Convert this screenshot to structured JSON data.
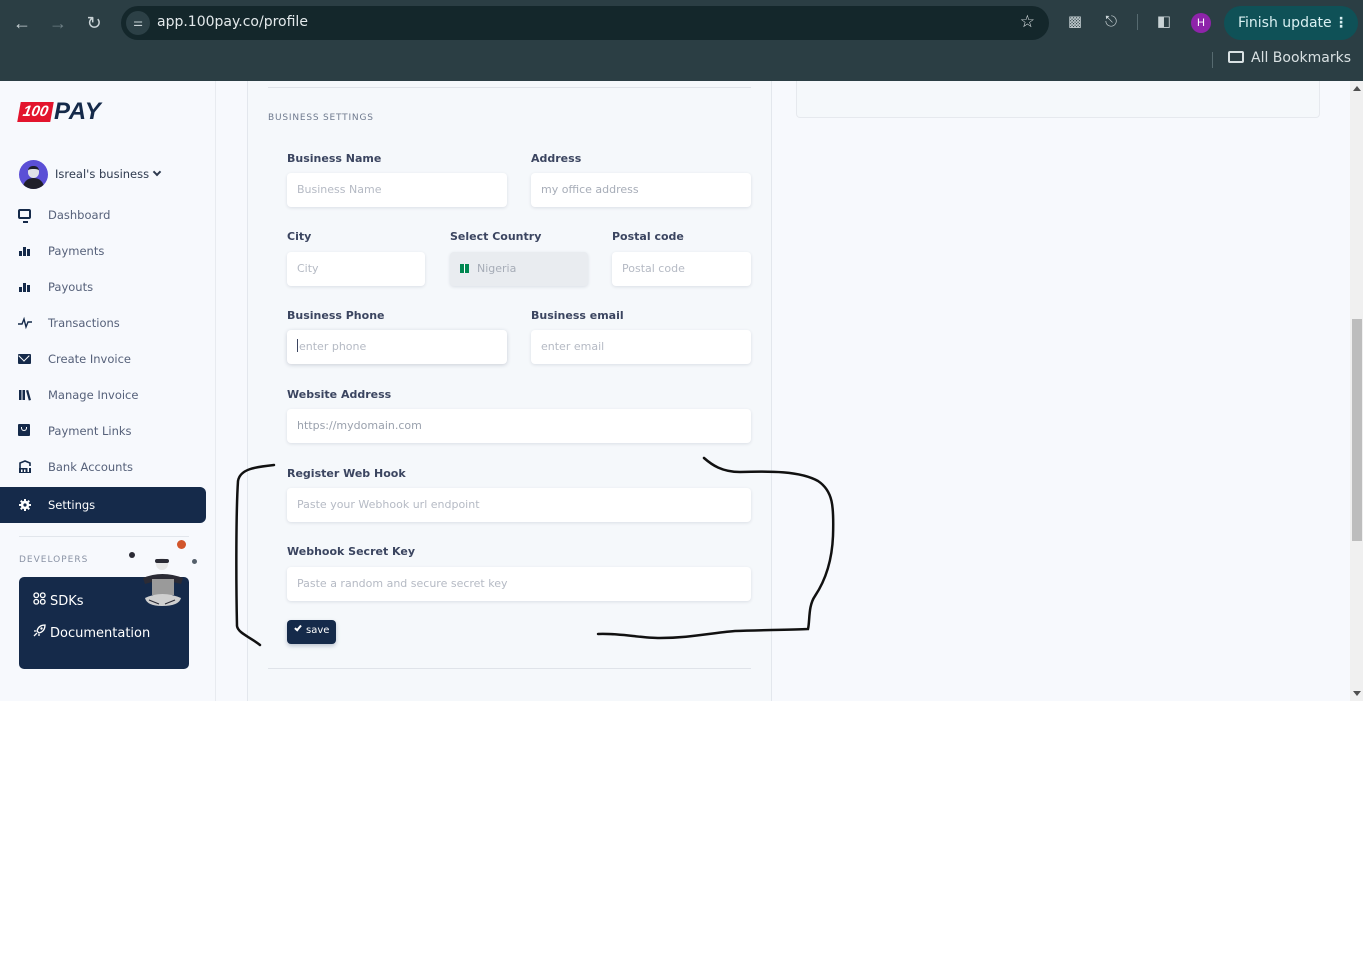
{
  "browser": {
    "url": "app.100pay.co/profile",
    "profile_initial": "H",
    "finish_update_label": "Finish update",
    "bookmarks_label": "All Bookmarks",
    "colors": {
      "chrome_bg": "#2b3e44",
      "omnibox_bg": "#14272b",
      "update_btn": "#0f5157",
      "profile": "#8e24aa"
    }
  },
  "app": {
    "logo": {
      "badge": "100",
      "text": "PAY",
      "badge_color": "#e3142d",
      "text_color": "#152a4a"
    },
    "business_switcher": {
      "name": "Isreal's business"
    },
    "sidebar": {
      "items": [
        {
          "label": "Dashboard",
          "icon": "monitor-icon"
        },
        {
          "label": "Payments",
          "icon": "bar-chart-icon"
        },
        {
          "label": "Payouts",
          "icon": "bar-chart-icon"
        },
        {
          "label": "Transactions",
          "icon": "activity-icon"
        },
        {
          "label": "Create Invoice",
          "icon": "envelope-icon"
        },
        {
          "label": "Manage Invoice",
          "icon": "library-icon"
        },
        {
          "label": "Payment Links",
          "icon": "inbox-icon"
        },
        {
          "label": "Bank Accounts",
          "icon": "bank-icon"
        },
        {
          "label": "Settings",
          "icon": "gear-icon",
          "active": true
        }
      ],
      "developers": {
        "title": "DEVELOPERS",
        "links": [
          {
            "label": "SDKs",
            "icon": "sdk-icon"
          },
          {
            "label": "Documentation",
            "icon": "rocket-icon"
          }
        ]
      },
      "accent": "#152a4a"
    },
    "business_settings": {
      "section_title": "BUSINESS SETTINGS",
      "fields": {
        "business_name": {
          "label": "Business Name",
          "placeholder": "Business Name",
          "value": ""
        },
        "address": {
          "label": "Address",
          "placeholder": "my office address",
          "value": ""
        },
        "city": {
          "label": "City",
          "placeholder": "City",
          "value": ""
        },
        "country": {
          "label": "Select Country",
          "value": "Nigeria",
          "flag": "nigeria-flag"
        },
        "postal_code": {
          "label": "Postal code",
          "placeholder": "Postal code",
          "value": ""
        },
        "business_phone": {
          "label": "Business Phone",
          "placeholder": "enter phone",
          "value": ""
        },
        "business_email": {
          "label": "Business email",
          "placeholder": "enter email",
          "value": ""
        },
        "website": {
          "label": "Website Address",
          "placeholder": "https://mydomain.com",
          "value": ""
        },
        "webhook_url": {
          "label": "Register Web Hook",
          "placeholder": "Paste your Webhook url endpoint",
          "value": ""
        },
        "webhook_secret": {
          "label": "Webhook Secret Key",
          "placeholder": "Paste a random and secure secret key",
          "value": ""
        }
      },
      "save_label": "save"
    }
  }
}
